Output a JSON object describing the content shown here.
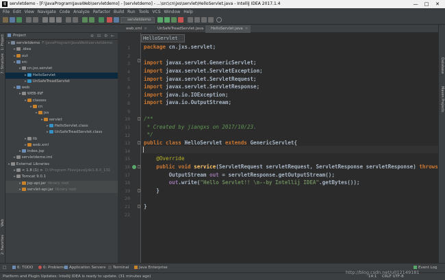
{
  "window": {
    "title": "servletdemo - [F:\\JavaProgram\\JavaWeb\\servletdemo] - [servletdemo] - ...\\src\\cn\\jxs\\servlet\\HelloServlet.java - IntelliJ IDEA 2017.1.4",
    "app_icon": "IJ"
  },
  "menu": [
    "File",
    "Edit",
    "View",
    "Navigate",
    "Code",
    "Analyze",
    "Refactor",
    "Build",
    "Run",
    "Tools",
    "VCS",
    "Window",
    "Help"
  ],
  "toolbar": {
    "run_config": "servletdemo"
  },
  "breadcrumbs": [
    "servletdemo",
    "src",
    "cn",
    "jxs",
    "servlet",
    "HelloServlet"
  ],
  "project": {
    "header": "Project",
    "root": "servletdemo",
    "root_path": "F:\\JavaProgram\\JavaWeb\\servletdemo",
    "tree": [
      {
        "label": "servletdemo",
        "extra": "F:\\JavaProgram\\JavaWeb\\servletdemo",
        "depth": 0,
        "color": "#7a8a9a"
      },
      {
        "label": ".idea",
        "extra": "",
        "depth": 1,
        "color": "#8c8c8c"
      },
      {
        "label": "out",
        "extra": "",
        "depth": 1,
        "color": "#c9842b"
      },
      {
        "label": "src",
        "extra": "",
        "depth": 1,
        "color": "#6a8cb5"
      },
      {
        "label": "cn.jxs.servlet",
        "extra": "",
        "depth": 2,
        "color": "#8c8c8c"
      },
      {
        "label": "HelloServlet",
        "extra": "",
        "depth": 3,
        "color": "#3592c4",
        "selected": true
      },
      {
        "label": "UnSafeTreadServlet",
        "extra": "",
        "depth": 3,
        "color": "#3592c4"
      },
      {
        "label": "web",
        "extra": "",
        "depth": 1,
        "color": "#6a8cb5"
      },
      {
        "label": "WEB-INF",
        "extra": "",
        "depth": 2,
        "color": "#8c8c8c"
      },
      {
        "label": "classes",
        "extra": "",
        "depth": 3,
        "color": "#c9842b"
      },
      {
        "label": "cn",
        "extra": "",
        "depth": 4,
        "color": "#c9842b"
      },
      {
        "label": "jxs",
        "extra": "",
        "depth": 5,
        "color": "#c9842b"
      },
      {
        "label": "servlet",
        "extra": "",
        "depth": 6,
        "color": "#c9842b"
      },
      {
        "label": "HelloServlet.class",
        "extra": "",
        "depth": 7,
        "color": "#3592c4"
      },
      {
        "label": "UnSafeTreadServlet.class",
        "extra": "",
        "depth": 7,
        "color": "#3592c4"
      },
      {
        "label": "lib",
        "extra": "",
        "depth": 3,
        "color": "#8c8c8c"
      },
      {
        "label": "web.xml",
        "extra": "",
        "depth": 3,
        "color": "#c9842b"
      },
      {
        "label": "index.jsp",
        "extra": "",
        "depth": 2,
        "color": "#6a8cb5"
      },
      {
        "label": "servletdemo.iml",
        "extra": "",
        "depth": 1,
        "color": "#8c8c8c"
      },
      {
        "label": "External Libraries",
        "extra": "",
        "depth": 0,
        "color": "#8c8c8c"
      },
      {
        "label": "< 1.8 (1) >",
        "extra": "D:\\Program Files\\Java\\jdk1.8.0_131",
        "depth": 1,
        "color": "#8c8c8c"
      },
      {
        "label": "Tomcat 9.0.1",
        "extra": "",
        "depth": 1,
        "color": "#8c8c8c"
      },
      {
        "label": "jsp-api.jar",
        "extra": "library root",
        "depth": 2,
        "color": "#c9842b",
        "shaded": true
      },
      {
        "label": "servlet-api.jar",
        "extra": "library root",
        "depth": 2,
        "color": "#c9842b",
        "shaded": true
      }
    ]
  },
  "left_strip": {
    "top": [
      "1: Project",
      "7: Structure"
    ],
    "bottom": [
      "Web",
      "2: Favorites"
    ]
  },
  "right_strip": [
    "Database",
    "Maven Projects"
  ],
  "tabs": [
    {
      "label": "web.xml",
      "active": false
    },
    {
      "label": "UnSafeTreadServlet.java",
      "active": false
    },
    {
      "label": "HelloServlet.java",
      "active": true
    }
  ],
  "editor": {
    "tooltip": "HelloServlet",
    "line_numbers": [
      "1",
      "2",
      "3",
      "4",
      "5",
      "6",
      "7",
      "8",
      "9",
      "10",
      "11",
      "12",
      "13",
      "14",
      "15",
      "16",
      "17",
      "18",
      "19",
      "20",
      "21",
      "22"
    ]
  },
  "code": {
    "l1": "package cn.jxs.servlet;",
    "l3": "import javax.servlet.GenericServlet;",
    "l4": "import javax.servlet.ServletException;",
    "l5": "import javax.servlet.ServletRequest;",
    "l6": "import javax.servlet.ServletResponse;",
    "l7": "import java.io.IOException;",
    "l8": "import java.io.OutputStream;",
    "l10": "/**",
    "l11": " * Created by jiangxs on 2017/10/23.",
    "l12": " */",
    "l13": "public class HelloServlet extends GenericServlet{",
    "l15": "    @Override",
    "l16": "    public void service(ServletRequest servletRequest, ServletResponse servletResponse) throws",
    "l17": "        OutputStream out = servletResponse.getOutputStream();",
    "l18": "        out.write(\"Hello Servlet!! \\n--by Intellij IDEA\".getBytes());",
    "l19": "    }",
    "l21": "}"
  },
  "bottom_tools": [
    "6: TODO",
    "0: Problems",
    "Application Servers",
    "Terminal",
    "Java Enterprise",
    "Event Log"
  ],
  "status": {
    "message": "Platform and Plugin Updates: IntelliJ IDEA is ready to update. (31 minutes ago)",
    "position": "14:1",
    "encoding": "CRLF   UTF-8"
  },
  "watermark": "http://blog.csdn.net/u012149181",
  "colors": {
    "background": "#2b2b2b",
    "keyword": "#cc7832",
    "comment": "#629755",
    "annotation": "#bbb529",
    "string": "#6a8759",
    "selection": "#0d293e"
  }
}
